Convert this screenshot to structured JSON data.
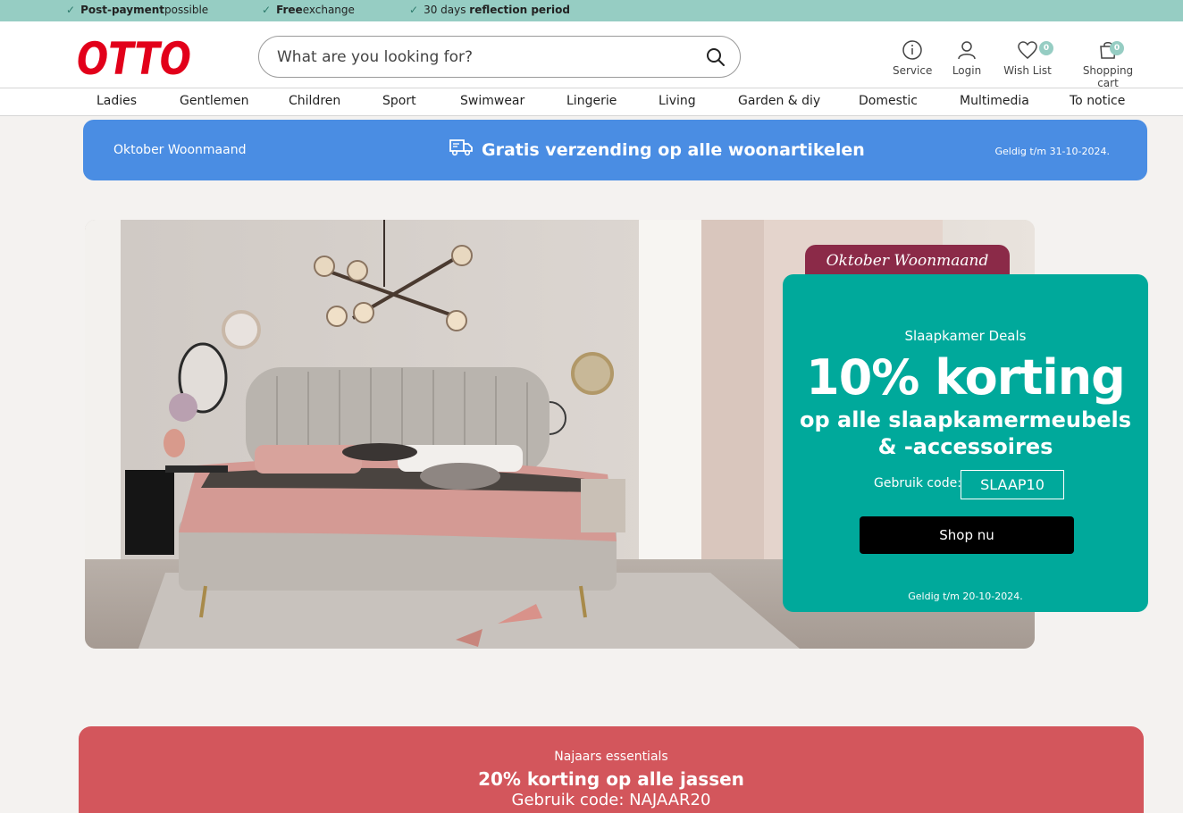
{
  "usp": [
    {
      "bold": "Post-payment",
      "rest": " possible",
      "bold_first": true
    },
    {
      "bold": "Free",
      "rest": " exchange",
      "bold_first": true
    },
    {
      "plain": "30 days ",
      "bold": "reflection period",
      "bold_first": false
    }
  ],
  "brand": {
    "logo_text": "OTTO",
    "logo_color": "#e2001a"
  },
  "search": {
    "placeholder": "What are you looking for?",
    "value": ""
  },
  "header_icons": {
    "service": "Service",
    "login": "Login",
    "wishlist": "Wish List",
    "wishlist_count": "0",
    "cart": "Shopping cart",
    "cart_count": "0"
  },
  "nav": [
    "Ladies",
    "Gentlemen",
    "Children",
    "Sport",
    "Swimwear",
    "Lingerie",
    "Living",
    "Garden & diy",
    "Domestic",
    "Multimedia",
    "To notice"
  ],
  "promo_strip": {
    "left": "Oktober Woonmaand",
    "center": "Gratis verzending op alle woonartikelen",
    "right": "Geldig t/m 31-10-2024."
  },
  "hero": {
    "tab": "Oktober Woonmaand",
    "subtitle": "Slaapkamer Deals",
    "headline": "10% korting",
    "desc_line1": "op alle slaapkamermeubels",
    "desc_line2": "& -accessoires",
    "code_label": "Gebruik code:",
    "code": "SLAAP10",
    "cta": "Shop nu",
    "valid": "Geldig t/m 20-10-2024."
  },
  "red_banner": {
    "kicker": "Najaars essentials",
    "headline": "20% korting op alle jassen",
    "code_line": "Gebruik code: NAJAAR20"
  },
  "colors": {
    "usp_bar": "#96cdc3",
    "promo_blue": "#4a8de3",
    "deal_teal": "#00a99b",
    "tab_maroon": "#8b2a48",
    "banner_red": "#d3565c"
  }
}
